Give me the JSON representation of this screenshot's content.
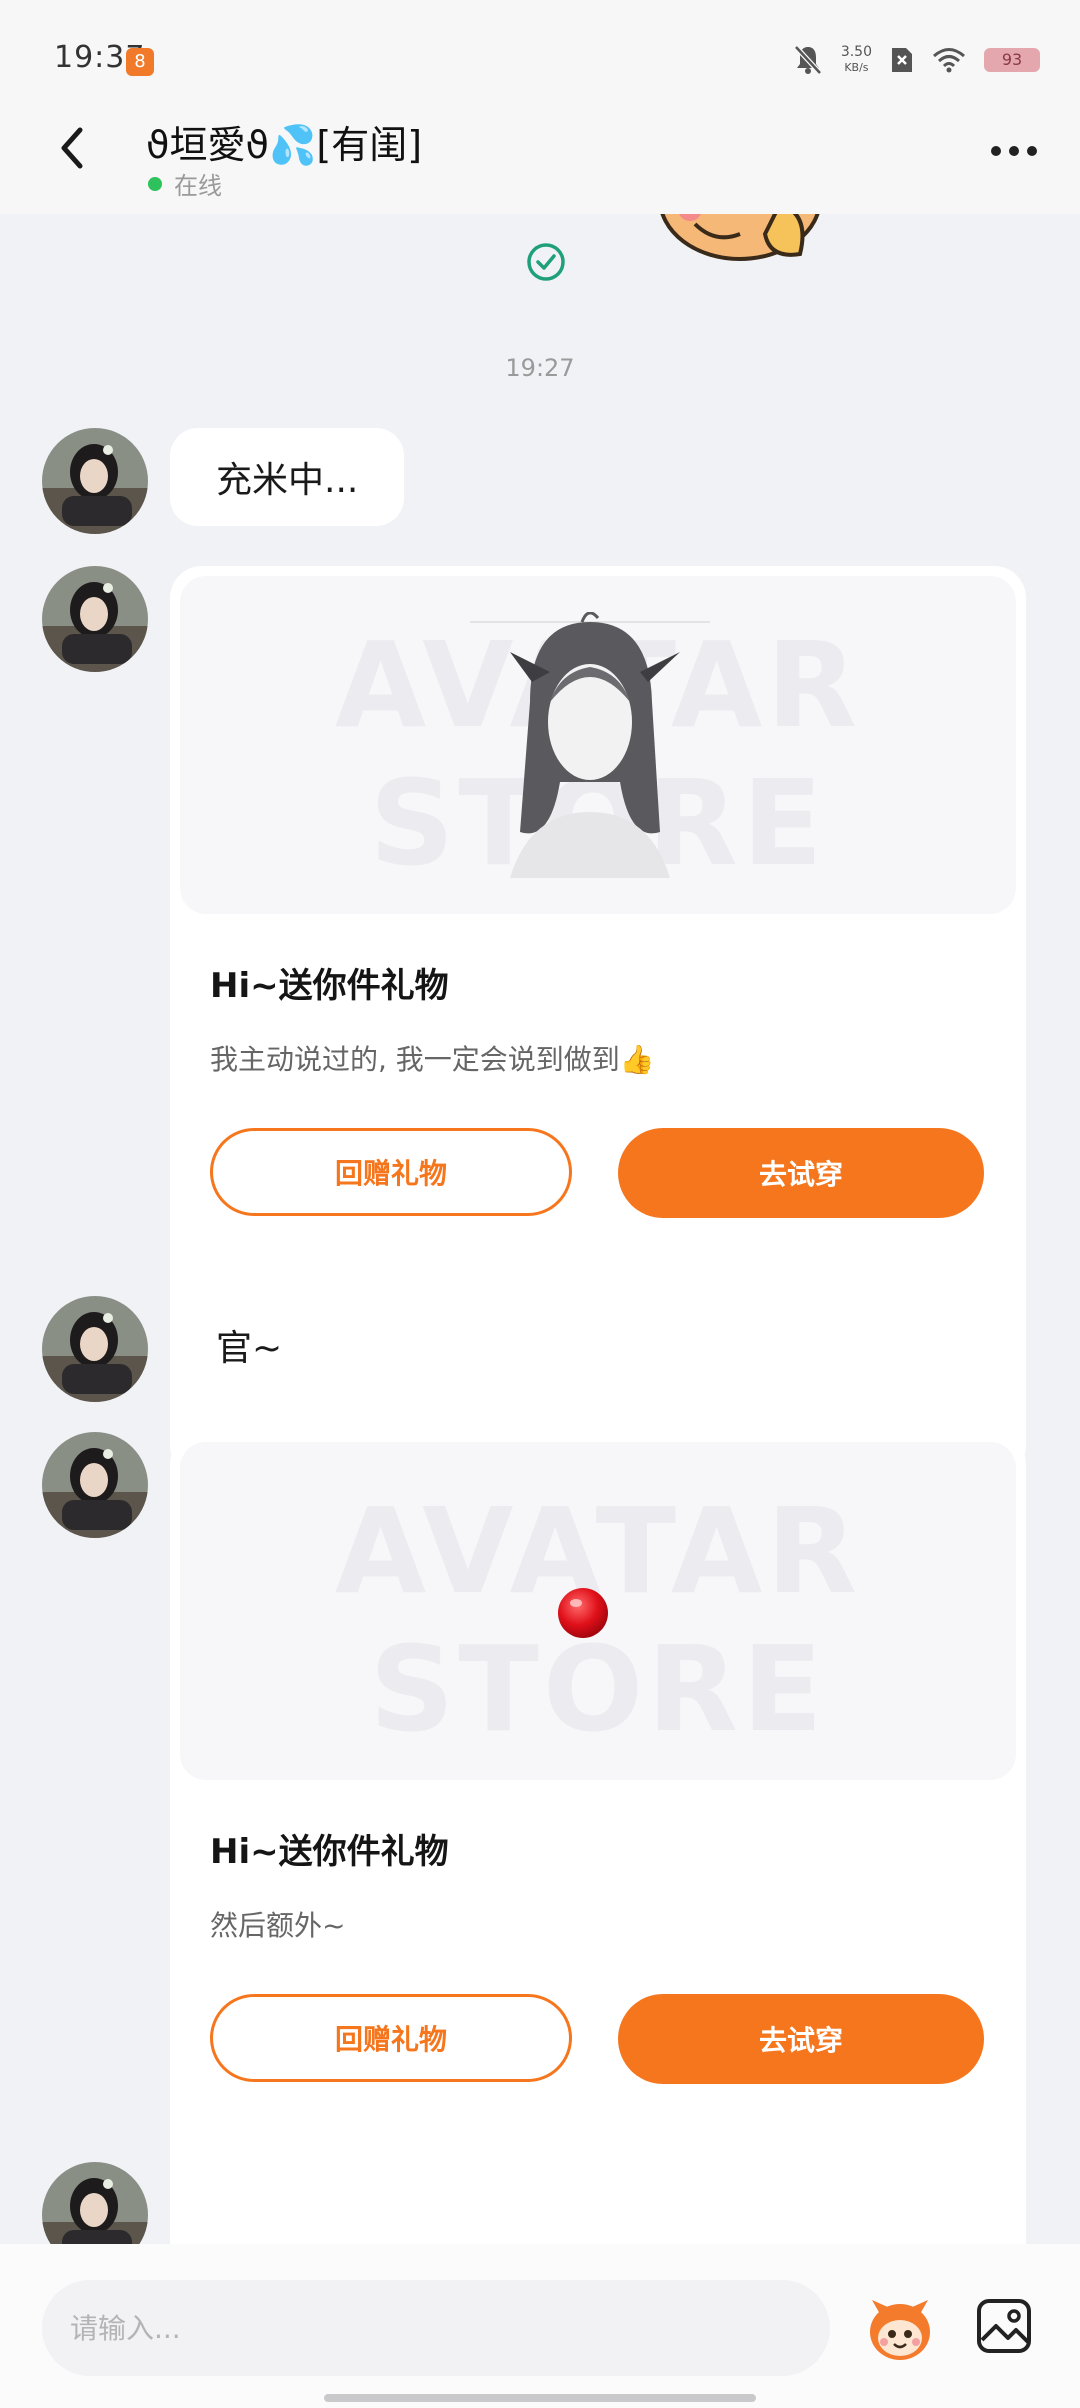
{
  "status_bar": {
    "time": "19:37",
    "app_icon": "app-icon",
    "net_speed_value": "3.50",
    "net_speed_unit": "KB/s",
    "battery": "93"
  },
  "header": {
    "title": "ϑ垣愛ϑ💦[有闺]",
    "status": "在线"
  },
  "chat": {
    "time_separator": "19:27",
    "messages": [
      {
        "type": "text",
        "text": "充米中..."
      },
      {
        "type": "gift",
        "watermark": "AVATAR STORE",
        "title": "Hi~送你件礼物",
        "desc": "我主动说过的, 我一定会说到做到👍",
        "return_gift_label": "回赠礼物",
        "try_on_label": "去试穿"
      },
      {
        "type": "text",
        "text": "官~"
      },
      {
        "type": "gift",
        "watermark": "AVATAR STORE",
        "title": "Hi~送你件礼物",
        "desc": "然后额外~",
        "return_gift_label": "回赠礼物",
        "try_on_label": "去试穿"
      }
    ]
  },
  "input_bar": {
    "placeholder": "请输入..."
  },
  "colors": {
    "accent": "#f5761c",
    "online": "#2fc15b",
    "background": "#f1f2f6"
  }
}
